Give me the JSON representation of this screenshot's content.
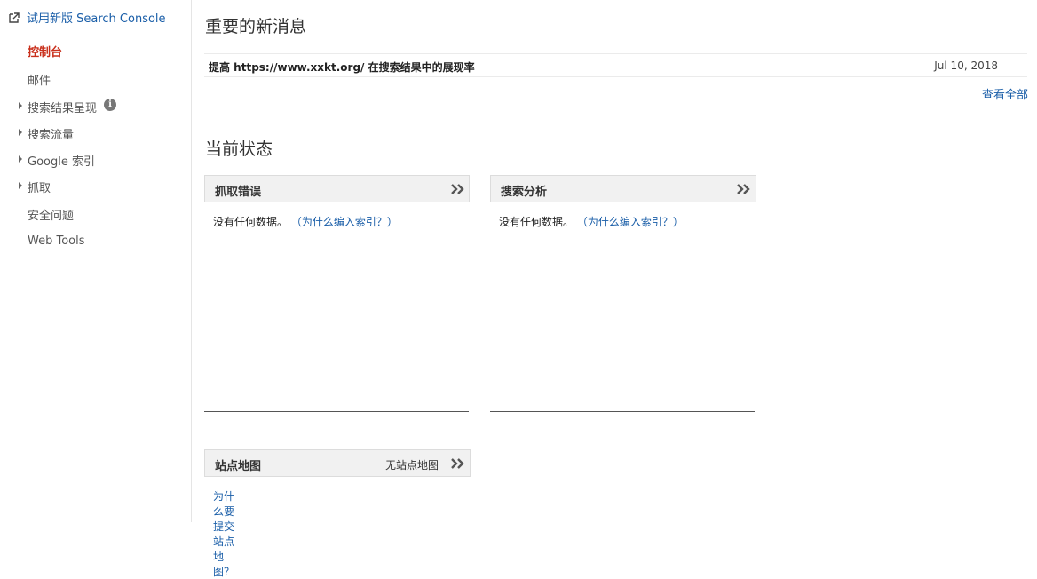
{
  "sidebar": {
    "try_new": "试用新版 Search Console",
    "items": [
      {
        "label": "控制台",
        "active": true
      },
      {
        "label": "邮件"
      },
      {
        "label": "搜索结果呈现",
        "expandable": true
      },
      {
        "label": "搜索流量",
        "expandable": true
      },
      {
        "label": "Google 索引",
        "expandable": true
      },
      {
        "label": "抓取",
        "expandable": true
      },
      {
        "label": "安全问题"
      },
      {
        "label": "Web Tools"
      }
    ]
  },
  "messages": {
    "title": "重要的新消息",
    "items": [
      {
        "text": "提高 https://www.xxkt.org/ 在搜索结果中的展现率",
        "date": "Jul 10, 2018"
      }
    ],
    "view_all": "查看全部"
  },
  "status": {
    "title": "当前状态",
    "cards": [
      {
        "title": "抓取错误",
        "body": "没有任何数据。",
        "link": "（为什么编入索引？）"
      },
      {
        "title": "搜索分析",
        "body": "没有任何数据。",
        "link": "（为什么编入索引？）"
      }
    ],
    "sitemap": {
      "title": "站点地图",
      "status": "无站点地图",
      "link": "为什么要提交站点地图？"
    }
  },
  "colors": {
    "link": "#1a5ea8",
    "active": "#c9301c",
    "header_bg": "#f1f1f1"
  }
}
